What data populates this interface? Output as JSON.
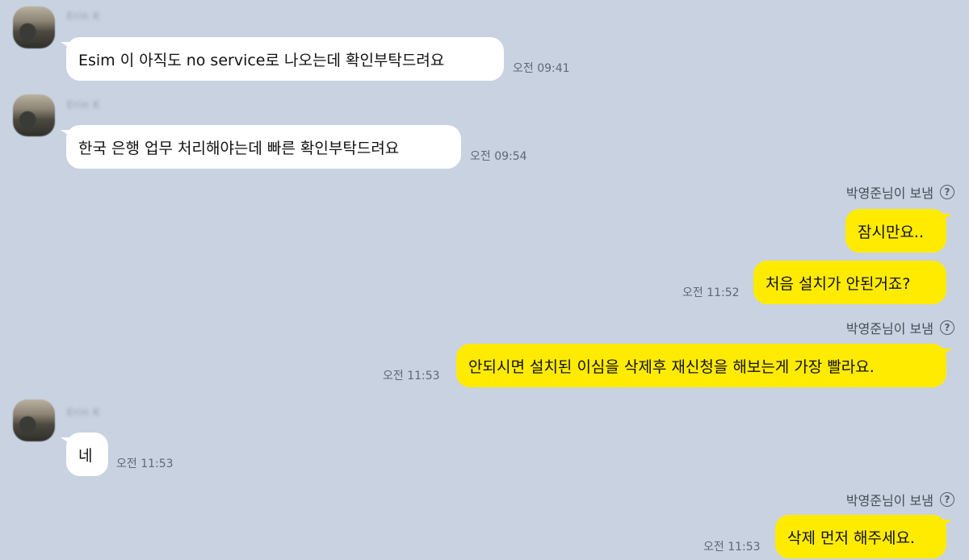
{
  "chat": {
    "incoming": [
      {
        "text": "Esim 이 아직도 no service로 나오는데 확인부탁드려요",
        "time": "오전 09:41"
      },
      {
        "text": "한국 은행 업무 처리해야는데 빠른 확인부탁드려요",
        "time": "오전 09:54"
      },
      {
        "text": "네",
        "time": "오전 11:53"
      }
    ],
    "outgoing": [
      {
        "sent_by": "박영준님이 보냄",
        "text": "잠시만요..",
        "time": ""
      },
      {
        "text": "처음 설치가 안된거죠?",
        "time": "오전 11:52"
      },
      {
        "sent_by": "박영준님이 보냄",
        "text": "안되시면 설치된 이심을 삭제후 재신청을 해보는게 가장 빨라요.",
        "time": "오전 11:53"
      },
      {
        "sent_by": "박영준님이 보냄",
        "text": "삭제 먼저 해주세요.",
        "time": "오전 11:53"
      }
    ],
    "help_icon": "question-circle-icon",
    "colors": {
      "background": "#c9d2e0",
      "incoming_bubble": "#ffffff",
      "outgoing_bubble": "#ffeb00"
    }
  }
}
